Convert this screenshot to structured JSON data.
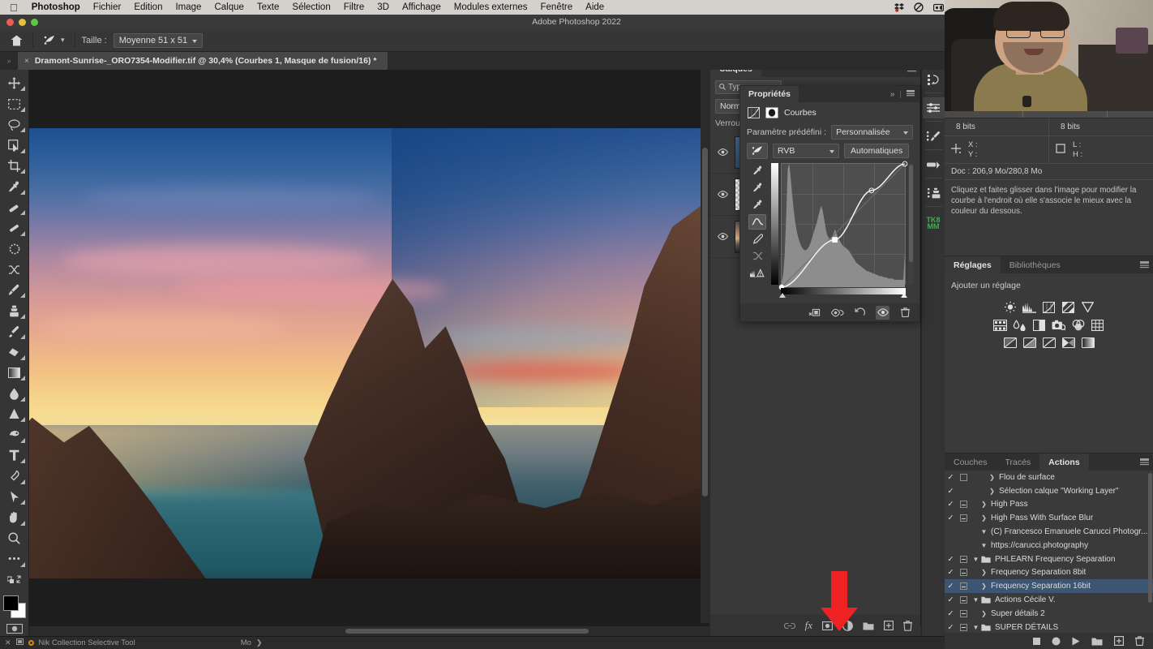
{
  "menubar": {
    "apple_icon": "apple-logo-icon",
    "items": [
      {
        "label": "Photoshop",
        "bold": true
      },
      {
        "label": "Fichier",
        "bold": false
      },
      {
        "label": "Edition",
        "bold": false
      },
      {
        "label": "Image",
        "bold": false
      },
      {
        "label": "Calque",
        "bold": false
      },
      {
        "label": "Texte",
        "bold": false
      },
      {
        "label": "Sélection",
        "bold": false
      },
      {
        "label": "Filtre",
        "bold": false
      },
      {
        "label": "3D",
        "bold": false
      },
      {
        "label": "Affichage",
        "bold": false
      },
      {
        "label": "Modules externes",
        "bold": false
      },
      {
        "label": "Fenêtre",
        "bold": false
      },
      {
        "label": "Aide",
        "bold": false
      }
    ],
    "status_icons": [
      "dropbox-icon",
      "do-not-disturb-icon",
      "screen-record-icon",
      "display-icon",
      "clipboard-icon",
      "clock-icon",
      "binoculars-icon",
      "stats-icon",
      "airplay-icon",
      "volume-icon",
      "control-center-icon",
      "wifi-icon",
      "flag-icon"
    ]
  },
  "window": {
    "title": "Adobe Photoshop 2022"
  },
  "optionsbar": {
    "home_icon": "home-icon",
    "tool_icon": "selective-tool-icon",
    "size_label": "Taille :",
    "size_value": "Moyenne 51 x 51"
  },
  "document": {
    "tab_title": "Dramont-Sunrise-_ORO7354-Modifier.tif @ 30,4% (Courbes 1, Masque de fusion/16) *",
    "close_glyph": "×"
  },
  "toolbar": {
    "tools": [
      {
        "name": "move-tool",
        "sub": true
      },
      {
        "name": "rectangular-marquee-tool",
        "sub": true
      },
      {
        "name": "lasso-tool",
        "sub": true
      },
      {
        "name": "object-selection-tool",
        "sub": true
      },
      {
        "name": "crop-tool",
        "sub": true
      },
      {
        "name": "eyedropper-tool",
        "sub": true
      },
      {
        "name": "healing-brush-tool",
        "sub": true
      },
      {
        "name": "patch-tool",
        "sub": true
      },
      {
        "name": "selective-tool",
        "sub": false
      },
      {
        "name": "shuffle-tool",
        "sub": false
      },
      {
        "name": "brush-tool",
        "sub": true
      },
      {
        "name": "clone-stamp-tool",
        "sub": true
      },
      {
        "name": "history-brush-tool",
        "sub": true
      },
      {
        "name": "eraser-tool",
        "sub": true
      },
      {
        "name": "gradient-tool",
        "sub": true
      },
      {
        "name": "blur-tool",
        "sub": true
      },
      {
        "name": "dodge-tool",
        "sub": true
      },
      {
        "name": "type-tool",
        "sub": true
      },
      {
        "name": "pen-tool",
        "sub": true
      },
      {
        "name": "path-selection-tool",
        "sub": true
      },
      {
        "name": "hand-tool",
        "sub": true
      },
      {
        "name": "zoom-tool",
        "sub": false
      },
      {
        "name": "more-tools",
        "sub": true
      }
    ],
    "foreground_color": "#000000",
    "background_color": "#ffffff"
  },
  "statusbar": {
    "tool_name": "Nik Collection Selective Tool",
    "memory_label": "Mo",
    "arrow_glyph": "❯"
  },
  "layers_panel": {
    "tab": "Calques",
    "filter_placeholder": "Typ",
    "blend_mode": "Norma",
    "lock_label": "Verrou",
    "rows": [
      {
        "name": "layer-row-1",
        "thumb": "th-blue"
      },
      {
        "name": "layer-row-2",
        "thumb": "th-mask"
      },
      {
        "name": "layer-row-3",
        "thumb": "th-warm"
      }
    ],
    "bottom_icons": [
      "link-layers-icon",
      "layer-style-fx-icon",
      "add-layer-mask-icon",
      "new-adjustment-layer-icon",
      "new-group-icon",
      "new-layer-icon",
      "delete-layer-icon"
    ]
  },
  "properties_panel": {
    "tab": "Propriétés",
    "expand_glyph": "»",
    "adjustment_name": "Courbes",
    "preset_label": "Paramètre prédéfini :",
    "preset_value": "Personnalisée",
    "channel_value": "RVB",
    "auto_button": "Automatiques",
    "eyedroppers": [
      "black-point-eyedropper",
      "gray-point-eyedropper",
      "white-point-eyedropper",
      "curve-point-tool",
      "pencil-draw-tool",
      "smooth-curve-tool",
      "histogram-warning-icon"
    ],
    "bottom_icons": [
      "clip-to-layer-icon",
      "view-previous-state-icon",
      "reset-adjustment-icon",
      "toggle-visibility-icon",
      "delete-adjustment-icon"
    ]
  },
  "curve_data": {
    "type": "line",
    "title": "Courbes RVB",
    "xlim": [
      0,
      255
    ],
    "ylim": [
      0,
      255
    ],
    "grid": true,
    "points": [
      {
        "x": 0,
        "y": 0
      },
      {
        "x": 110,
        "y": 98
      },
      {
        "x": 186,
        "y": 200
      },
      {
        "x": 255,
        "y": 255
      }
    ],
    "histogram": [
      4,
      10,
      26,
      58,
      96,
      100,
      88,
      74,
      62,
      52,
      45,
      40,
      36,
      33,
      31,
      30,
      30,
      31,
      33,
      36,
      40,
      44,
      48,
      52,
      57,
      62,
      66,
      62,
      55,
      47,
      42,
      40,
      39,
      40,
      43,
      47,
      44,
      40,
      38,
      36,
      34,
      33,
      32,
      31,
      30,
      28,
      26,
      24,
      22,
      20,
      19,
      18,
      17,
      16,
      15,
      14,
      13,
      13,
      12,
      12,
      11,
      11,
      10,
      10,
      9,
      9,
      9,
      8,
      8,
      8,
      7,
      7,
      7,
      7,
      6,
      6,
      6,
      6,
      6,
      6,
      6,
      28
    ]
  },
  "dock": {
    "collapse_glyph": "«",
    "icons": [
      "history-panel-icon",
      "camera-raw-filter-icon",
      "brush-settings-icon",
      "gradient-panel-icon",
      "clone-source-icon"
    ],
    "plugin_logo_line1": "TK8",
    "plugin_logo_line2": "MM"
  },
  "info_panel": {
    "bit_depth_left": "8 bits",
    "bit_depth_right": "8 bits",
    "pointer_icon": "crosshair-icon",
    "x_label": "X :",
    "y_label": "Y :",
    "marquee_icon": "marquee-icon",
    "w_label": "L :",
    "h_label": "H :",
    "doc_info": "Doc : 206,9 Mo/280,8 Mo",
    "hint": "Cliquez et faites glisser dans l'image pour modifier la courbe à l'endroit où elle s'associe le mieux avec la couleur du dessous."
  },
  "adjustments_panel": {
    "tabs": [
      {
        "label": "Réglages",
        "active": true
      },
      {
        "label": "Bibliothèques",
        "active": false
      }
    ],
    "add_label": "Ajouter un réglage",
    "row1": [
      "brightness-contrast-icon",
      "levels-icon",
      "curves-icon",
      "exposure-icon",
      "vibrance-icon"
    ],
    "row2": [
      "hue-saturation-icon",
      "color-balance-icon",
      "black-white-icon",
      "photo-filter-icon",
      "channel-mixer-icon",
      "color-lookup-icon"
    ],
    "row3": [
      "invert-icon",
      "posterize-icon",
      "threshold-icon",
      "selective-color-icon",
      "gradient-map-icon"
    ]
  },
  "actions_panel": {
    "tabs": [
      {
        "label": "Couches",
        "active": false
      },
      {
        "label": "Tracés",
        "active": false
      },
      {
        "label": "Actions",
        "active": true
      }
    ],
    "rows": [
      {
        "label": "Flou de surface",
        "check": true,
        "box": "empty",
        "indent": 2,
        "caret": "closed",
        "folder": false,
        "selected": false
      },
      {
        "label": "Sélection calque \"Working Layer\"",
        "check": true,
        "box": "none",
        "indent": 2,
        "caret": "closed",
        "folder": false,
        "selected": false
      },
      {
        "label": "High Pass",
        "check": true,
        "box": "filled",
        "indent": 1,
        "caret": "closed",
        "folder": false,
        "selected": false
      },
      {
        "label": "High Pass With Surface Blur",
        "check": true,
        "box": "filled",
        "indent": 1,
        "caret": "closed",
        "folder": false,
        "selected": false
      },
      {
        "label": "(C) Francesco Emanuele Carucci Photogr...",
        "check": false,
        "box": "none",
        "indent": 1,
        "caret": "open",
        "folder": false,
        "selected": false
      },
      {
        "label": "https://carucci.photography",
        "check": false,
        "box": "none",
        "indent": 1,
        "caret": "open",
        "folder": false,
        "selected": false
      },
      {
        "label": "PHLEARN Frequency Separation",
        "check": true,
        "box": "filled",
        "indent": 0,
        "caret": "open",
        "folder": true,
        "selected": false
      },
      {
        "label": "Frequency Separation 8bit",
        "check": true,
        "box": "filled",
        "indent": 1,
        "caret": "closed",
        "folder": false,
        "selected": false
      },
      {
        "label": "Frequency Separation 16bit",
        "check": true,
        "box": "filled",
        "indent": 1,
        "caret": "closed",
        "folder": false,
        "selected": true
      },
      {
        "label": "Actions Cécile V.",
        "check": true,
        "box": "filled",
        "indent": 0,
        "caret": "open",
        "folder": true,
        "selected": false
      },
      {
        "label": "Super détails 2",
        "check": true,
        "box": "filled",
        "indent": 1,
        "caret": "closed",
        "folder": false,
        "selected": false
      },
      {
        "label": "SUPER DÉTAILS",
        "check": true,
        "box": "filled",
        "indent": 0,
        "caret": "open",
        "folder": true,
        "selected": false
      }
    ],
    "bottom_icons": [
      "stop-recording-icon",
      "record-icon",
      "play-icon",
      "new-set-icon",
      "new-action-icon",
      "delete-action-icon"
    ]
  },
  "annotation": {
    "arrow_name": "red-annotation-arrow",
    "color": "#ee2222"
  }
}
